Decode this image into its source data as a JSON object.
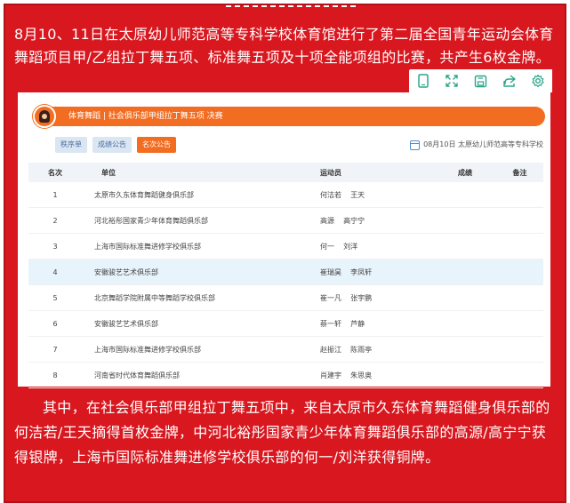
{
  "article": {
    "para1": "8月10、11日在太原幼儿师范高等专科学校体育馆进行了第二届全国青年运动会体育舞蹈项目甲/乙组拉丁舞五项、标准舞五项及十项全能项组的比赛，共产生6枚金牌。",
    "para2": "其中，在社会俱乐部甲组拉丁舞五项中，来自太原市久东体育舞蹈健身俱乐部的何洁若/王天摘得首枚金牌，中河北裕彤国家青少年体育舞蹈俱乐部的高源/高宁宁获得银牌，上海市国际标准舞进修学校俱乐部的何一/刘洋获得铜牌。"
  },
  "toolbar": {
    "icons": [
      "phone-icon",
      "expand-icon",
      "save-icon",
      "share-icon",
      "settings-icon"
    ]
  },
  "screenshot": {
    "title": "体育舞蹈 | 社会俱乐部甲组拉丁舞五项 决赛",
    "tabs": [
      {
        "label": "秩序单",
        "active": false
      },
      {
        "label": "成绩公告",
        "active": false
      },
      {
        "label": "名次公告",
        "active": true
      }
    ],
    "meta": "08月10日 太原幼儿师范高等专科学校",
    "headers": {
      "rank": "名次",
      "unit": "单位",
      "athletes": "运动员",
      "score": "成绩",
      "note": "备注"
    },
    "rows": [
      {
        "rank": "1",
        "unit": "太原市久东体育舞蹈健身俱乐部",
        "athletes": "何洁若    王天"
      },
      {
        "rank": "2",
        "unit": "河北裕彤国家青少年体育舞蹈俱乐部",
        "athletes": "高源    高宁宁"
      },
      {
        "rank": "3",
        "unit": "上海市国际标准舞进修学校俱乐部",
        "athletes": "何一    刘洋"
      },
      {
        "rank": "4",
        "unit": "安徽骏艺艺术俱乐部",
        "athletes": "崔瑞昊    李凤轩"
      },
      {
        "rank": "5",
        "unit": "北京舞蹈学院附属中等舞蹈学校俱乐部",
        "athletes": "崔一凡    张宇鹏"
      },
      {
        "rank": "6",
        "unit": "安徽骏艺艺术俱乐部",
        "athletes": "蔡一轩    芦静"
      },
      {
        "rank": "7",
        "unit": "上海市国际标准舞进修学校俱乐部",
        "athletes": "赵振江    陈雨亭"
      },
      {
        "rank": "8",
        "unit": "河南省时代体育舞蹈俱乐部",
        "athletes": "肖建宇    朱思奥"
      }
    ]
  },
  "colors": {
    "frame": "#d8171f",
    "accent": "#f26d21",
    "highlight_row": "#e8f4fc"
  }
}
